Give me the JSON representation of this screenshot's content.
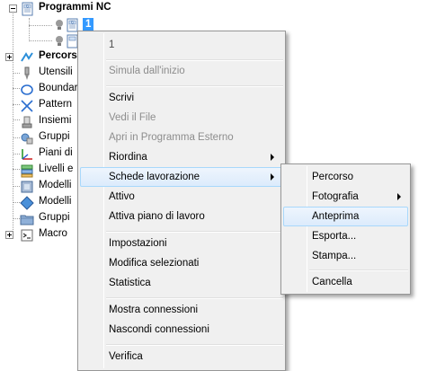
{
  "tree": {
    "root_label": "Programmi NC",
    "child_label": "1",
    "items": [
      {
        "label": "Percorsi",
        "icon": "toolpath-icon"
      },
      {
        "label": "Utensili",
        "icon": "tool-icon"
      },
      {
        "label": "Boundaries",
        "icon": "boundary-icon"
      },
      {
        "label": "Pattern",
        "icon": "pattern-icon"
      },
      {
        "label": "Insiemi",
        "icon": "feature-set-icon"
      },
      {
        "label": "Gruppi",
        "icon": "group-icon"
      },
      {
        "label": "Piani di",
        "icon": "workplane-icon"
      },
      {
        "label": "Livelli e",
        "icon": "levels-icon"
      },
      {
        "label": "Modelli",
        "icon": "model-icon"
      },
      {
        "label": "Modelli",
        "icon": "stock-model-icon"
      },
      {
        "label": "Gruppi",
        "icon": "folder-icon"
      },
      {
        "label": "Macro",
        "icon": "macro-icon"
      }
    ]
  },
  "context_menu": {
    "header": "1",
    "items": [
      "Simula dall'inizio",
      "Scrivi",
      "Vedi il File",
      "Apri in Programma Esterno",
      "Riordina",
      "Schede lavorazione",
      "Attivo",
      "Attiva piano di lavoro",
      "Impostazioni",
      "Modifica selezionati",
      "Statistica",
      "Mostra connessioni",
      "Nascondi connessioni",
      "Verifica"
    ]
  },
  "submenu": {
    "items": [
      "Percorso",
      "Fotografia",
      "Anteprima",
      "Esporta...",
      "Stampa...",
      "Cancella"
    ]
  },
  "colors": {
    "selection": "#3399ff",
    "menu_bg": "#f0f0f0",
    "highlight_border": "#a8d8fb"
  }
}
